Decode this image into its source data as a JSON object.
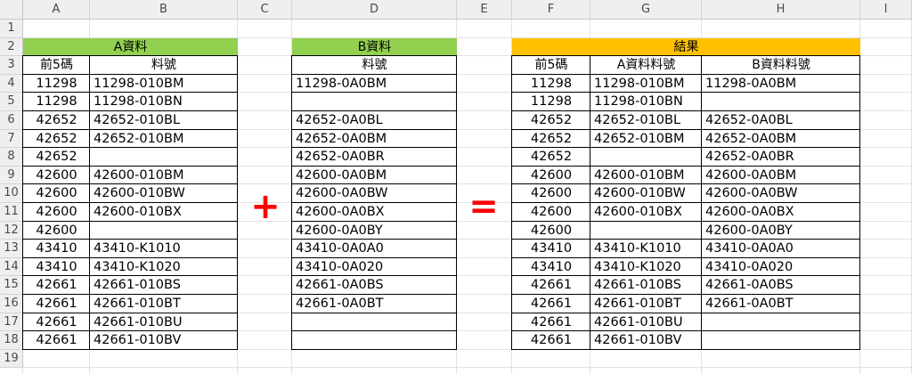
{
  "columns": [
    "A",
    "B",
    "C",
    "D",
    "E",
    "F",
    "G",
    "H",
    "I"
  ],
  "rows": [
    "1",
    "2",
    "3",
    "4",
    "5",
    "6",
    "7",
    "8",
    "9",
    "10",
    "11",
    "12",
    "13",
    "14",
    "15",
    "16",
    "17",
    "18",
    "19"
  ],
  "tableA": {
    "title": "A資料",
    "headers": [
      "前5碼",
      "料號"
    ],
    "rows": [
      [
        "11298",
        "11298-010BM"
      ],
      [
        "11298",
        "11298-010BN"
      ],
      [
        "42652",
        "42652-010BL"
      ],
      [
        "42652",
        "42652-010BM"
      ],
      [
        "42652",
        ""
      ],
      [
        "42600",
        "42600-010BM"
      ],
      [
        "42600",
        "42600-010BW"
      ],
      [
        "42600",
        "42600-010BX"
      ],
      [
        "42600",
        ""
      ],
      [
        "43410",
        "43410-K1010"
      ],
      [
        "43410",
        "43410-K1020"
      ],
      [
        "42661",
        "42661-010BS"
      ],
      [
        "42661",
        "42661-010BT"
      ],
      [
        "42661",
        "42661-010BU"
      ],
      [
        "42661",
        "42661-010BV"
      ]
    ]
  },
  "tableB": {
    "title": "B資料",
    "headers": [
      "料號"
    ],
    "rows": [
      [
        "11298-0A0BM"
      ],
      [
        ""
      ],
      [
        "42652-0A0BL"
      ],
      [
        "42652-0A0BM"
      ],
      [
        "42652-0A0BR"
      ],
      [
        "42600-0A0BM"
      ],
      [
        "42600-0A0BW"
      ],
      [
        "42600-0A0BX"
      ],
      [
        "42600-0A0BY"
      ],
      [
        "43410-0A0A0"
      ],
      [
        "43410-0A020"
      ],
      [
        "42661-0A0BS"
      ],
      [
        "42661-0A0BT"
      ],
      [
        ""
      ],
      [
        ""
      ]
    ]
  },
  "tableResult": {
    "title": "結果",
    "headers": [
      "前5碼",
      "A資料料號",
      "B資料料號"
    ],
    "rows": [
      [
        "11298",
        "11298-010BM",
        "11298-0A0BM"
      ],
      [
        "11298",
        "11298-010BN",
        ""
      ],
      [
        "42652",
        "42652-010BL",
        "42652-0A0BL"
      ],
      [
        "42652",
        "42652-010BM",
        "42652-0A0BM"
      ],
      [
        "42652",
        "",
        "42652-0A0BR"
      ],
      [
        "42600",
        "42600-010BM",
        "42600-0A0BM"
      ],
      [
        "42600",
        "42600-010BW",
        "42600-0A0BW"
      ],
      [
        "42600",
        "42600-010BX",
        "42600-0A0BX"
      ],
      [
        "42600",
        "",
        "42600-0A0BY"
      ],
      [
        "43410",
        "43410-K1010",
        "43410-0A0A0"
      ],
      [
        "43410",
        "43410-K1020",
        "43410-0A020"
      ],
      [
        "42661",
        "42661-010BS",
        "42661-0A0BS"
      ],
      [
        "42661",
        "42661-010BT",
        "42661-0A0BT"
      ],
      [
        "42661",
        "42661-010BU",
        ""
      ],
      [
        "42661",
        "42661-010BV",
        ""
      ]
    ]
  },
  "operators": {
    "plus": "+",
    "equals": "="
  },
  "colors": {
    "green_fill": "#92d050",
    "orange_fill": "#ffc000",
    "operator": "#ff0000"
  }
}
